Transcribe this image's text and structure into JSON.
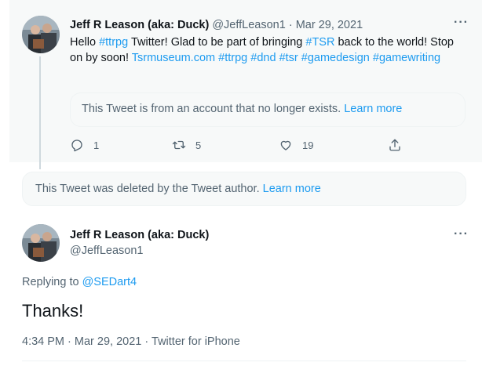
{
  "parent_tweet": {
    "display_name": "Jeff R Leason (aka: Duck)",
    "handle": "@JeffLeason1",
    "separator": "·",
    "date": "Mar 29, 2021",
    "text_parts": {
      "hello": "Hello ",
      "tag_ttrpg": "#ttrpg",
      "mid1": " Twitter! Glad to be part of bringing ",
      "tag_tsr": "#TSR",
      "mid2": " back to the world! Stop on by soon! ",
      "site": "Tsrmuseum.com",
      "tag_ttrpg2": "#ttrpg",
      "tag_dnd": "#dnd",
      "tag_tsr2": "#tsr",
      "tag_gamedesign": "#gamedesign",
      "tag_gamewriting": "#gamewriting"
    },
    "quote": {
      "text": "This Tweet is from an account that no longer exists.",
      "link": "Learn more"
    },
    "actions": {
      "replies": "1",
      "retweets": "5",
      "likes": "19"
    }
  },
  "deleted_tweet": {
    "text": "This Tweet was deleted by the Tweet author.",
    "link": "Learn more"
  },
  "main_tweet": {
    "display_name": "Jeff R Leason (aka: Duck)",
    "handle": "@JeffLeason1",
    "replying_to_label": "Replying to ",
    "replying_to_handle": "@SEDart4",
    "text": "Thanks!",
    "time": "4:34 PM",
    "separator": "·",
    "date": "Mar 29, 2021",
    "source": "Twitter for iPhone"
  },
  "ui": {
    "more_glyph": "···"
  },
  "colors": {
    "link": "#1d9bf0",
    "muted": "#536471",
    "text": "#0f1419",
    "highlight_bg": "#f7f9f9",
    "border": "#eff3f4"
  },
  "icons": {
    "reply": "reply-icon",
    "retweet": "retweet-icon",
    "like": "heart-icon",
    "share": "share-icon",
    "more": "more-icon"
  }
}
